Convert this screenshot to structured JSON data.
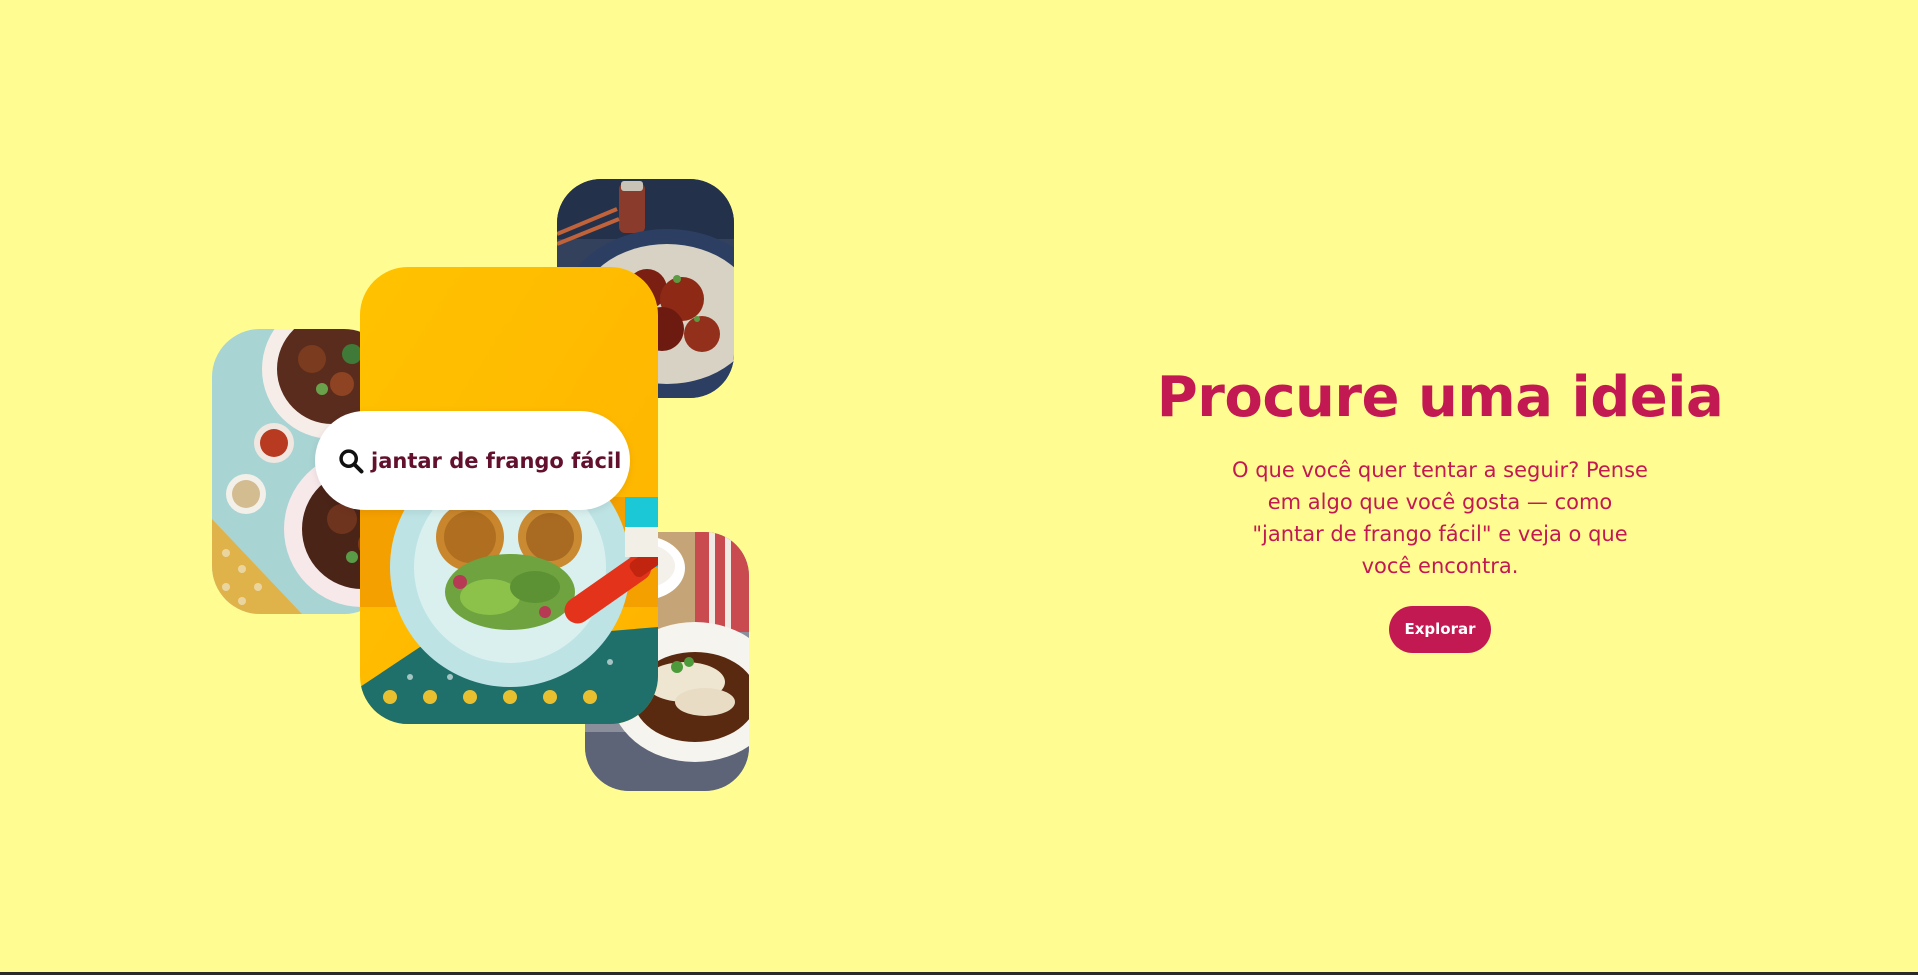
{
  "hero": {
    "search_query": "jantar de frango fácil",
    "title": "Procure uma ideia",
    "description": "O que você quer tentar a seguir? Pense em algo que você gosta — como \"jantar de frango fácil\" e veja o que você encontra.",
    "button_label": "Explorar"
  },
  "colors": {
    "background": "#fffd92",
    "accent": "#c31952",
    "search_text": "#62102d"
  },
  "icons": {
    "search": "search-icon"
  }
}
